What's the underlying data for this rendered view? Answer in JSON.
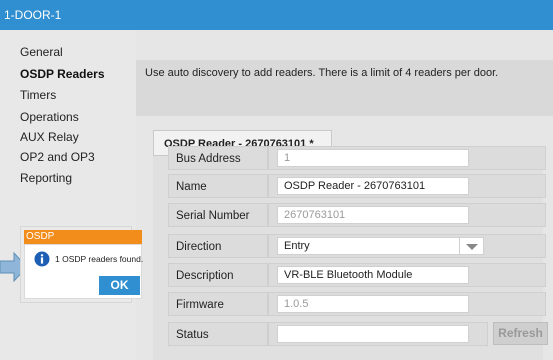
{
  "window": {
    "title": "1-DOOR-1"
  },
  "sidebar": {
    "items": [
      {
        "label": "General",
        "active": false
      },
      {
        "label": "OSDP Readers",
        "active": true
      },
      {
        "label": "Timers",
        "active": false
      },
      {
        "label": "Operations",
        "active": false
      },
      {
        "label": "AUX Relay",
        "active": false
      },
      {
        "label": "OP2 and OP3",
        "active": false
      },
      {
        "label": "Reporting",
        "active": false
      }
    ]
  },
  "main": {
    "hint": "Use auto discovery to add readers. There is a limit of 4 readers per door.",
    "tab_label": "OSDP Reader - 2670763101  *",
    "fields": {
      "bus_address": {
        "label": "Bus Address",
        "value": "1"
      },
      "name": {
        "label": "Name",
        "value": "OSDP Reader - 2670763101"
      },
      "serial_number": {
        "label": "Serial Number",
        "value": "2670763101"
      },
      "direction": {
        "label": "Direction",
        "value": "Entry"
      },
      "description": {
        "label": "Description",
        "value": "VR-BLE Bluetooth Module"
      },
      "firmware": {
        "label": "Firmware",
        "value": "1.0.5"
      },
      "status": {
        "label": "Status",
        "value": ""
      }
    },
    "refresh_label": "Refresh"
  },
  "dialog": {
    "title": "OSDP",
    "message": "1 OSDP readers found.",
    "ok_label": "OK"
  },
  "colors": {
    "accent": "#2f8fd1",
    "dialog_title": "#f28c1b"
  }
}
